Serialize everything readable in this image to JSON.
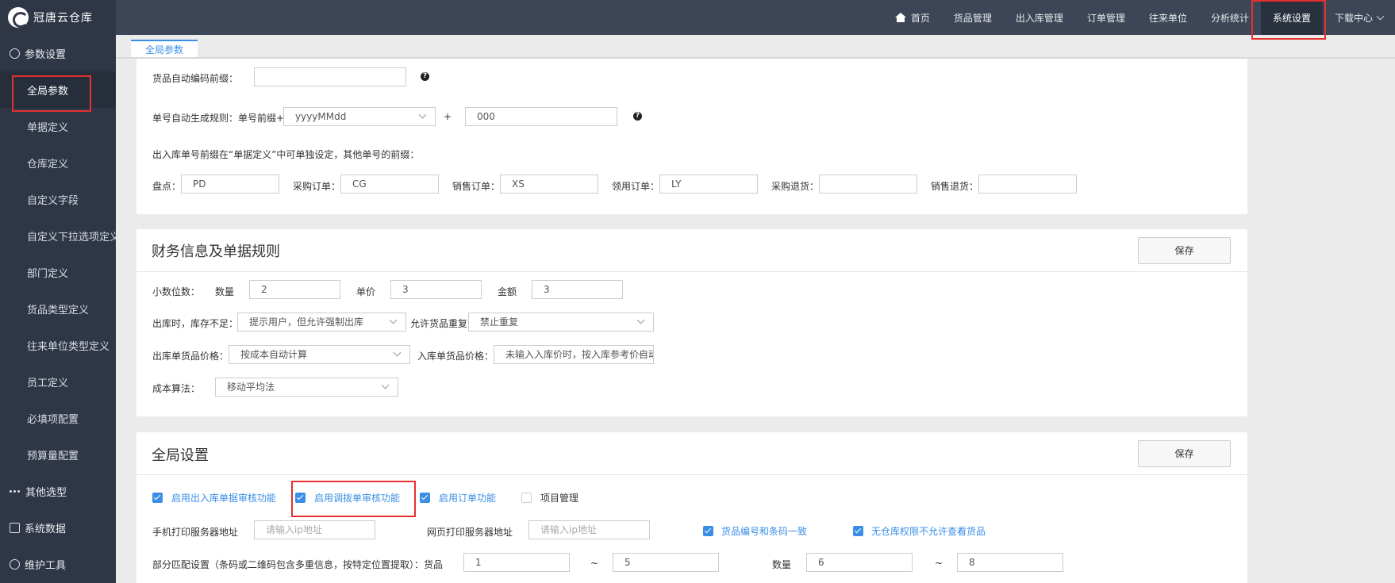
{
  "app": {
    "name": "冠唐云仓库"
  },
  "nav": {
    "items": [
      "首页",
      "货品管理",
      "出入库管理",
      "订单管理",
      "往来单位",
      "分析统计",
      "系统设置",
      "下载中心"
    ]
  },
  "sidebar": {
    "group1": "参数设置",
    "items": [
      "全局参数",
      "单据定义",
      "仓库定义",
      "自定义字段",
      "自定义下拉选项定义",
      "部门定义",
      "货品类型定义",
      "往来单位类型定义",
      "员工定义",
      "必填项配置",
      "预算量配置"
    ],
    "group2": "其他选型",
    "group3": "系统数据",
    "group4": "维护工具"
  },
  "tab": {
    "label": "全局参数"
  },
  "prefix_panel": {
    "auto_code_label": "货品自动编码前缀：",
    "auto_code_value": "",
    "rule_label": "单号自动生成规则：单号前缀+",
    "rule_format": "yyyyMMdd",
    "plus": "+",
    "rule_suffix": "000",
    "note": "出入库单号前缀在“单据定义”中可单独设定，其他单号的前缀：",
    "fields": [
      {
        "label": "盘点：",
        "value": "PD"
      },
      {
        "label": "采购订单：",
        "value": "CG"
      },
      {
        "label": "销售订单：",
        "value": "XS"
      },
      {
        "label": "领用订单：",
        "value": "LY"
      },
      {
        "label": "采购退货：",
        "value": ""
      },
      {
        "label": "销售退货：",
        "value": ""
      }
    ]
  },
  "finance_panel": {
    "title": "财务信息及单据规则",
    "save": "保存",
    "decimals_label": "小数位数：",
    "qty_label": "数量",
    "qty_value": "2",
    "price_label": "单价",
    "price_value": "3",
    "amount_label": "金额",
    "amount_value": "3",
    "stock_short_label": "出库时，库存不足：",
    "stock_short_value": "提示用户，但允许强制出库",
    "dup_label": "允许货品重复：",
    "dup_value": "禁止重复",
    "out_price_label": "出库单货品价格：",
    "out_price_value": "按成本自动计算",
    "in_price_label": "入库单货品价格：",
    "in_price_value": "未输入入库价时，按入库参考价自动",
    "cost_label": "成本算法：",
    "cost_value": "移动平均法"
  },
  "global_panel": {
    "title": "全局设置",
    "save": "保存",
    "checks": [
      {
        "label": "启用出入库单据审核功能",
        "checked": true
      },
      {
        "label": "启用调拨单审核功能",
        "checked": true
      },
      {
        "label": "启用订单功能",
        "checked": true
      },
      {
        "label": "项目管理",
        "checked": false
      }
    ],
    "mobile_print_label": "手机打印服务器地址",
    "mobile_print_placeholder": "请输入ip地址",
    "web_print_label": "网页打印服务器地址",
    "web_print_placeholder": "请输入ip地址",
    "check_code": "货品编号和条码一致",
    "check_perm": "无仓库权限不允许查看货品",
    "match_label": "部分匹配设置（条码或二维码包含多重信息，按特定位置提取）：货品",
    "goods_from": "1",
    "tilde": "~",
    "goods_to": "5",
    "qty_label": "数量",
    "qty_from": "6",
    "qty_to": "8"
  }
}
